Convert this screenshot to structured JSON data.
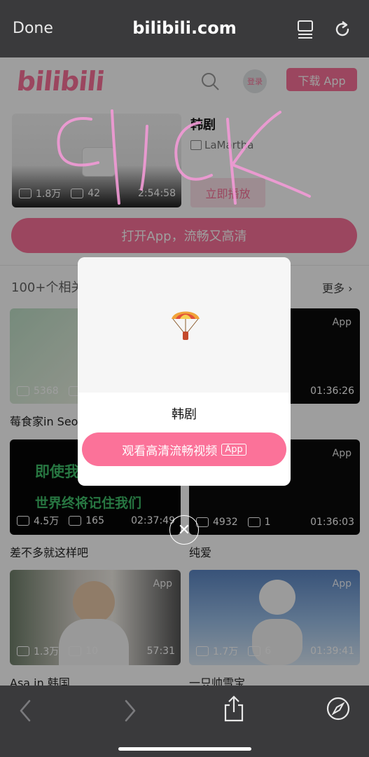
{
  "browser": {
    "done_label": "Done",
    "url": "bilibili.com",
    "icons": {
      "reader": "reader-view-icon",
      "reload": "reload-icon"
    }
  },
  "header": {
    "logo": "bilibili",
    "login_label": "登录",
    "download_label": "下载 App"
  },
  "hero": {
    "plays": "1.8万",
    "comments": "42",
    "duration": "2:54:58",
    "title": "韩剧",
    "uploader": "LaMartha",
    "play_button": "立即播放"
  },
  "open_app_button": "打开App，流畅又高清",
  "related": {
    "title": "100+个相关",
    "more": "更多",
    "videos": [
      {
        "plays": "5368",
        "comments": "",
        "duration": "",
        "badge": "",
        "title": "莓食家in Seo"
      },
      {
        "plays": "",
        "comments": "",
        "duration": "01:36:26",
        "badge": "App",
        "title": ""
      },
      {
        "plays": "4.5万",
        "comments": "165",
        "duration": "02:37:49",
        "badge": "",
        "title": "差不多就这样吧",
        "caption1": "即使我",
        "caption2": "世界终将记住我们"
      },
      {
        "plays": "4932",
        "comments": "1",
        "duration": "01:36:03",
        "badge": "App",
        "title": "纯爱"
      },
      {
        "plays": "1.3万",
        "comments": "10",
        "duration": "57:31",
        "badge": "App",
        "title": "Asa in 韩国"
      },
      {
        "plays": "1.7万",
        "comments": "6",
        "duration": "01:39:41",
        "badge": "App",
        "title": "一只帅雪宝"
      }
    ]
  },
  "dialog": {
    "title": "韩剧",
    "watch_button": "观看高清流畅视频",
    "app_badge": "App"
  },
  "annotation": "click",
  "colors": {
    "brand": "#fb7299",
    "bar": "#3a3a3c"
  }
}
